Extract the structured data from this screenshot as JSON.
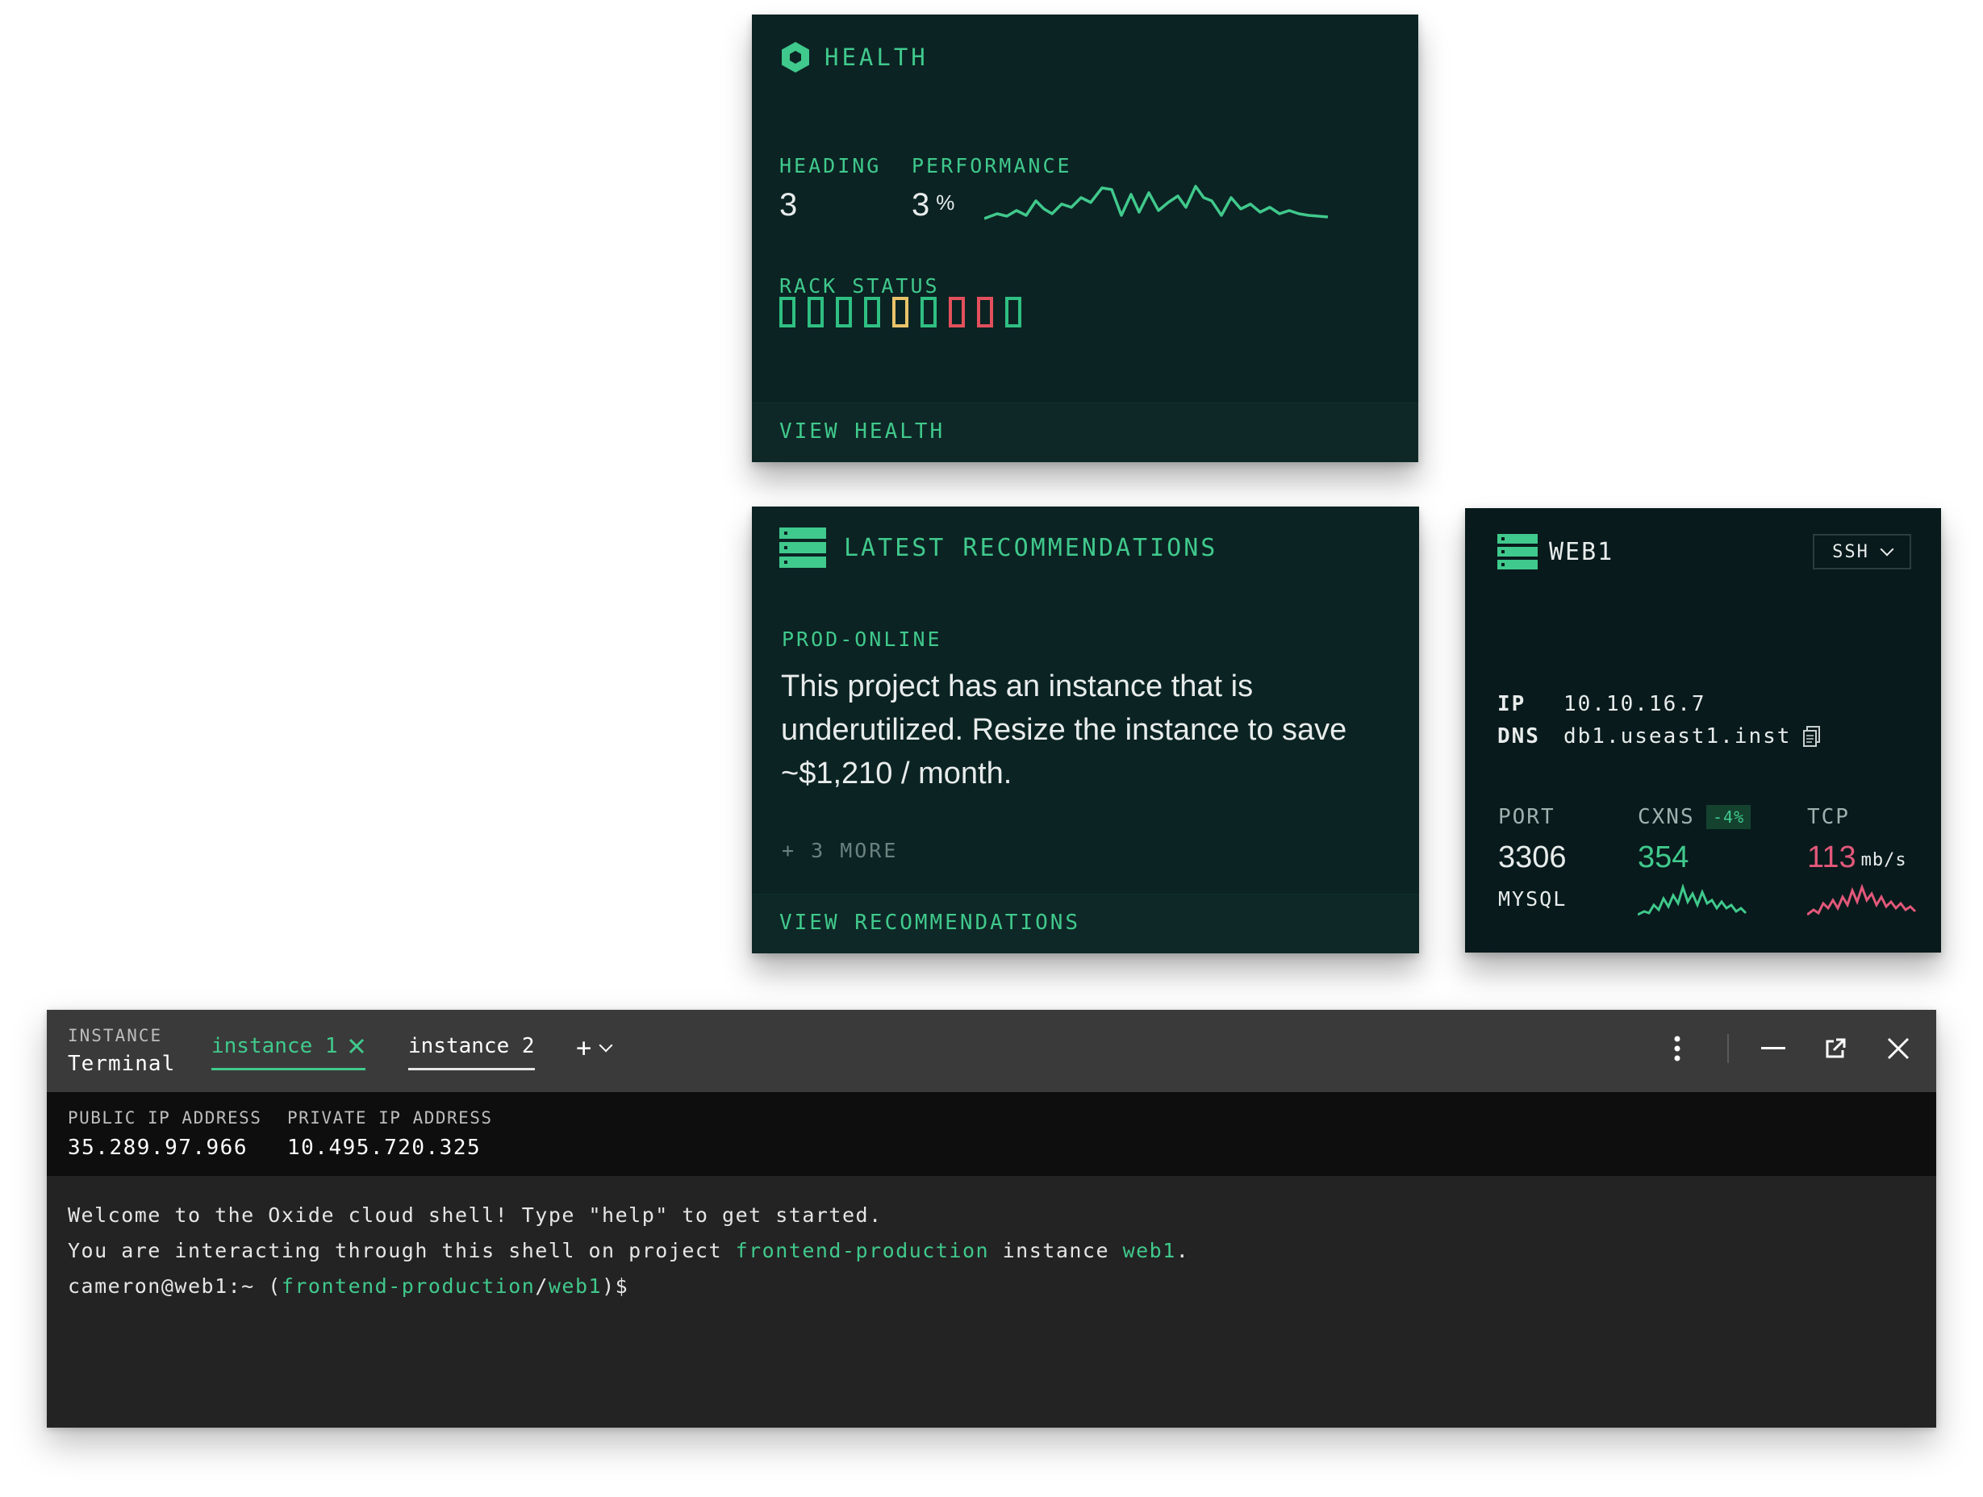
{
  "health": {
    "title": "HEALTH",
    "heading_label": "HEADING",
    "heading_value": "3",
    "performance_label": "PERFORMANCE",
    "performance_value": "3",
    "performance_unit": "%",
    "rack_label": "RACK STATUS",
    "rack_cells": [
      "ok",
      "ok",
      "ok",
      "ok",
      "warn",
      "ok",
      "error",
      "error",
      "ok"
    ],
    "footer_link": "VIEW HEALTH"
  },
  "recommendations": {
    "title": "LATEST RECOMMENDATIONS",
    "env": "PROD-ONLINE",
    "message": "This project has an instance that is underutilized. Resize the instance to save ~$1,210 / month.",
    "more": "+ 3 MORE",
    "footer_link": "VIEW RECOMMENDATIONS"
  },
  "web1": {
    "title": "WEB1",
    "connect_select": "SSH",
    "ip_label": "IP",
    "ip_value": "10.10.16.7",
    "dns_label": "DNS",
    "dns_value": "db1.useast1.inst",
    "port_label": "PORT",
    "port_value": "3306",
    "port_sub": "MYSQL",
    "cxns_label": "CXNS",
    "cxns_badge": "-4%",
    "cxns_value": "354",
    "tcp_label": "TCP",
    "tcp_value": "113",
    "tcp_unit": "mb/s"
  },
  "terminal": {
    "section_label": "INSTANCE",
    "section_title": "Terminal",
    "tabs": [
      {
        "label": "instance 1",
        "active": true
      },
      {
        "label": "instance 2",
        "active": false
      }
    ],
    "add_label": "+",
    "public_ip_label": "PUBLIC IP ADDRESS",
    "public_ip_value": "35.289.97.966",
    "private_ip_label": "PRIVATE IP ADDRESS",
    "private_ip_value": "10.495.720.325",
    "line1": "Welcome to the Oxide cloud shell! Type \"help\" to get started.",
    "line2_a": "You are interacting through this shell on project ",
    "line2_project": "frontend-production",
    "line2_b": " instance ",
    "line2_instance": "web1",
    "line2_c": ".",
    "line3_a": "cameron@web1:~ (",
    "line3_project": "frontend-production",
    "line3_sep": "/",
    "line3_instance": "web1",
    "line3_b": ")$"
  },
  "colors": {
    "accent_green": "#40c98c",
    "warn_yellow": "#e8c36a",
    "error_red": "#e2505c",
    "card_bg": "#0b2323"
  },
  "icons": {
    "health": "hexagon-icon",
    "recommendations": "server-stack-icon",
    "web1": "server-stack-icon",
    "dns_copy": "copy-icon"
  }
}
